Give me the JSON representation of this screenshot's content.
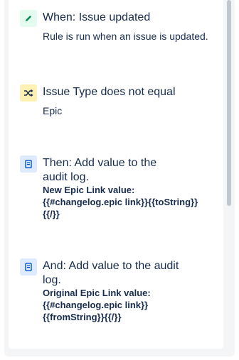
{
  "steps": [
    {
      "icon": "pencil-icon",
      "title": "When: Issue updated",
      "description": "Rule is run when an issue is updated."
    },
    {
      "icon": "shuffle-icon",
      "title": "Issue Type does not equal",
      "description": "Epic"
    },
    {
      "icon": "document-icon",
      "title_line1": "Then: Add value to the",
      "title_line2": "audit log.",
      "detail_line1": "New Epic Link value:",
      "detail_line2": "{{#changelog.epic link}}{{toString}}",
      "detail_line3": "{{/}}"
    },
    {
      "icon": "document-icon",
      "title_line1": "And: Add value to the audit",
      "title_line2": "log.",
      "detail_line1": "Original Epic Link value:",
      "detail_line2": "{{#changelog.epic link}}",
      "detail_line3": "{{fromString}}{{/}}"
    }
  ],
  "colors": {
    "trigger_icon": "#00875a",
    "condition_icon": "#ff991f",
    "action_icon": "#0052cc",
    "text": "#172b4d"
  }
}
